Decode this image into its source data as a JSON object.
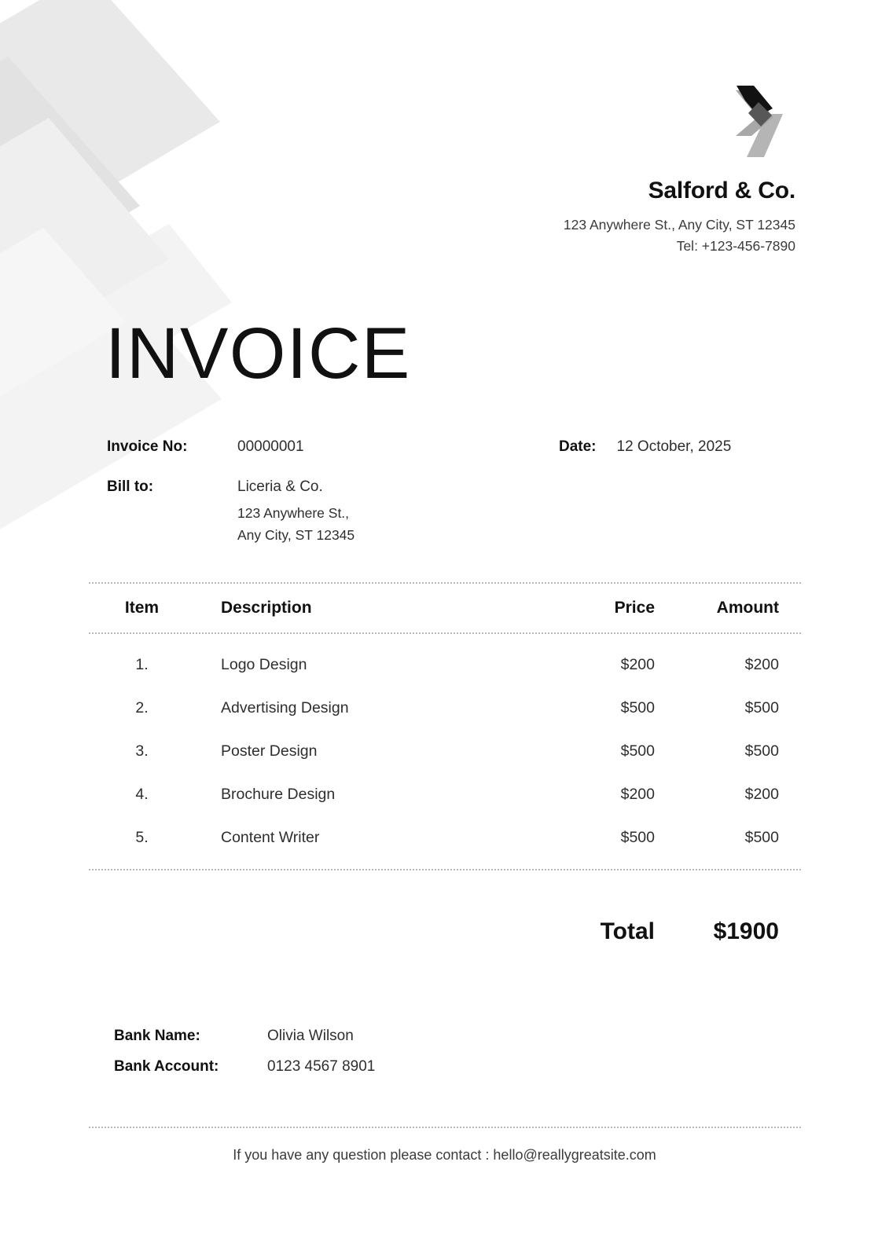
{
  "company": {
    "logo_icon": "double-chevron-logo",
    "logo_colors": {
      "chevron_dark": "#121212",
      "chevron_overlap": "#575757",
      "chevron_mid": "#a8a8a8",
      "bar_light": "#b5b5b5"
    },
    "name": "Salford & Co.",
    "address": "123 Anywhere St., Any City, ST 12345",
    "phone": "Tel: +123-456-7890"
  },
  "title": "INVOICE",
  "meta": {
    "invoice_no_label": "Invoice No:",
    "invoice_no_value": "00000001",
    "date_label": "Date:",
    "date_value": "12 October, 2025",
    "bill_to_label": "Bill to:",
    "bill_to_name": "Liceria & Co.",
    "bill_to_address_line1": "123 Anywhere St.,",
    "bill_to_address_line2": "Any City, ST 12345"
  },
  "table": {
    "headers": {
      "item": "Item",
      "description": "Description",
      "price": "Price",
      "amount": "Amount"
    },
    "rows": [
      {
        "item": "1.",
        "description": "Logo Design",
        "price": "$200",
        "amount": "$200"
      },
      {
        "item": "2.",
        "description": "Advertising Design",
        "price": "$500",
        "amount": "$500"
      },
      {
        "item": "3.",
        "description": "Poster Design",
        "price": "$500",
        "amount": "$500"
      },
      {
        "item": "4.",
        "description": "Brochure Design",
        "price": "$200",
        "amount": "$200"
      },
      {
        "item": "5.",
        "description": "Content Writer",
        "price": "$500",
        "amount": "$500"
      }
    ]
  },
  "total": {
    "label": "Total",
    "value": "$1900"
  },
  "bank": {
    "name_label": "Bank Name:",
    "name_value": "Olivia Wilson",
    "account_label": "Bank Account:",
    "account_value": "0123 4567 8901"
  },
  "footer": {
    "text": "If you have any question please contact : hello@reallygreatsite.com"
  },
  "theme": {
    "background": "#ffffff",
    "text": "#1a1a1a",
    "muted_text": "#2e2e2e",
    "rule": "#b9b9b9",
    "deco_light": "#f4f4f4",
    "deco_mid": "#ececec",
    "deco_dark": "#e2e2e2"
  }
}
